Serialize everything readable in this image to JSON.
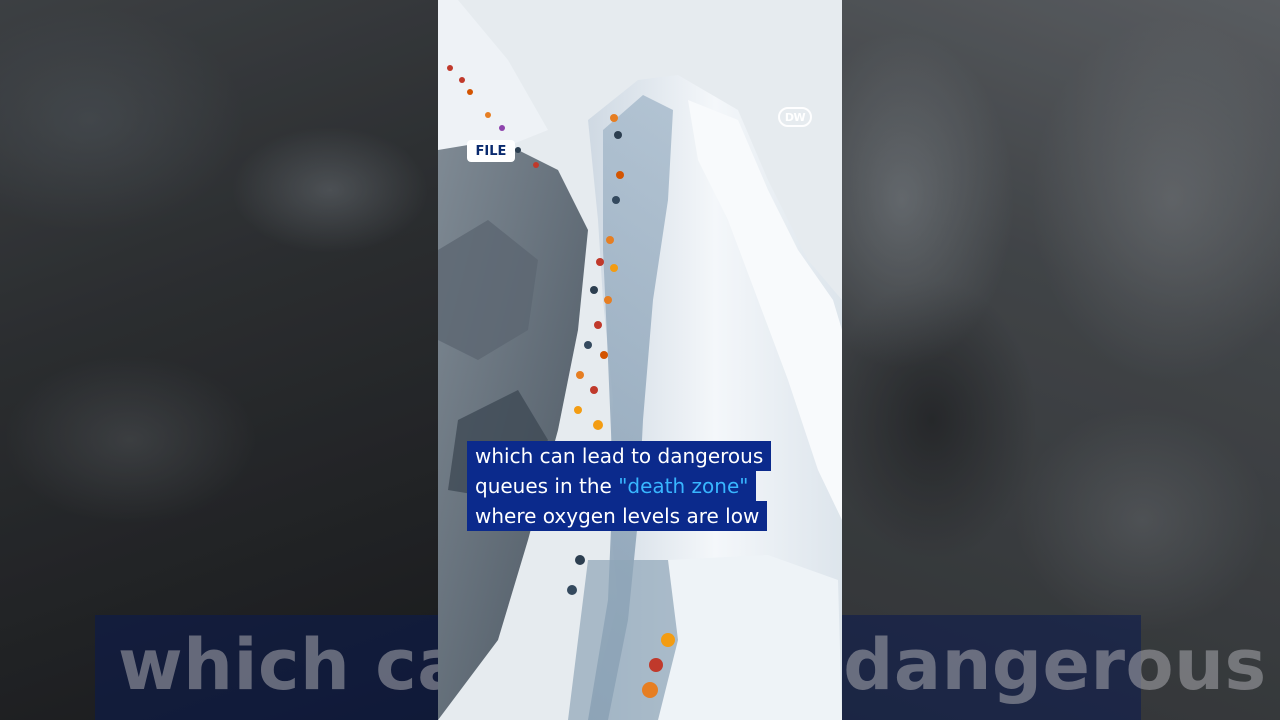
{
  "badge": {
    "label": "FILE"
  },
  "logo": {
    "text": "DW"
  },
  "caption": {
    "line1": "which can lead to dangerous",
    "line2_prefix": "queues in the ",
    "line2_highlight": "\"death zone\"",
    "line3": "where oxygen levels are low"
  },
  "background_echo": {
    "text": "which can lead to dangerous"
  },
  "colors": {
    "caption_bg": "#0b2a8c",
    "caption_text": "#ffffff",
    "highlight": "#38b6ff",
    "badge_text": "#0a2a6e"
  }
}
